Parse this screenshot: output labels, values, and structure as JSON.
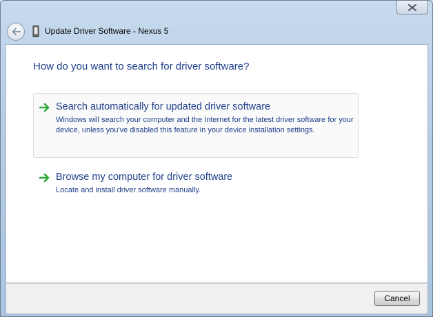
{
  "window": {
    "title": "Update Driver Software - Nexus 5"
  },
  "content": {
    "question": "How do you want to search for driver software?",
    "options": [
      {
        "title": "Search automatically for updated driver software",
        "description": "Windows will search your computer and the Internet for the latest driver software for your device, unless you've disabled this feature in your device installation settings."
      },
      {
        "title": "Browse my computer for driver software",
        "description": "Locate and install driver software manually."
      }
    ]
  },
  "footer": {
    "cancel_label": "Cancel"
  },
  "icons": {
    "back": "back-arrow-icon",
    "device": "phone-device-icon",
    "option_arrow": "green-arrow-icon",
    "close": "close-icon"
  },
  "colors": {
    "link_text": "#1e3f8a",
    "arrow_green": "#2fa83a",
    "titlebar_glass": "#b6cde6"
  }
}
